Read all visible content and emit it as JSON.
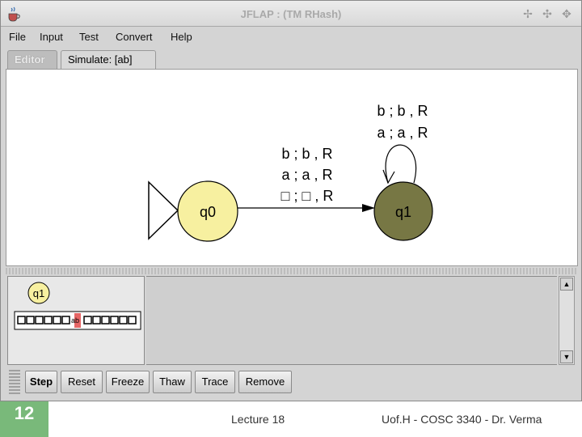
{
  "window": {
    "title": "JFLAP : (TM RHash)",
    "app_icon": "java-cup-icon",
    "controls": [
      "pin-icon",
      "resize-icon",
      "close-icon"
    ]
  },
  "menu": {
    "items": [
      "File",
      "Input",
      "Test",
      "Convert",
      "Help"
    ]
  },
  "tabs": {
    "editor": "Editor",
    "simulate": "Simulate: [ab]",
    "active": "Simulate: [ab]"
  },
  "diagram": {
    "states": [
      {
        "name": "q0",
        "initial": true,
        "highlight": "yellow"
      },
      {
        "name": "q1",
        "initial": false,
        "highlight": "dark-olive"
      }
    ],
    "transition_q0_q1": [
      "b ; b , R",
      "a ; a , R",
      "□ ; □ , R"
    ],
    "loop_q1": [
      "b ; b , R",
      "a ; a , R"
    ]
  },
  "simulation": {
    "current_state": "q1",
    "tape_text": "ab",
    "tape_blank_symbol": "□"
  },
  "buttons": [
    "Step",
    "Reset",
    "Freeze",
    "Thaw",
    "Trace",
    "Remove"
  ],
  "slide": {
    "number": "12",
    "lecture": "Lecture 18",
    "credit": "Uof.H - COSC 3340 - Dr. Verma"
  },
  "colors": {
    "state_q0_fill": "#f7f0a0",
    "state_q1_fill": "#777744",
    "tape_head": "#dd3333",
    "slide_badge": "#79b97a"
  }
}
